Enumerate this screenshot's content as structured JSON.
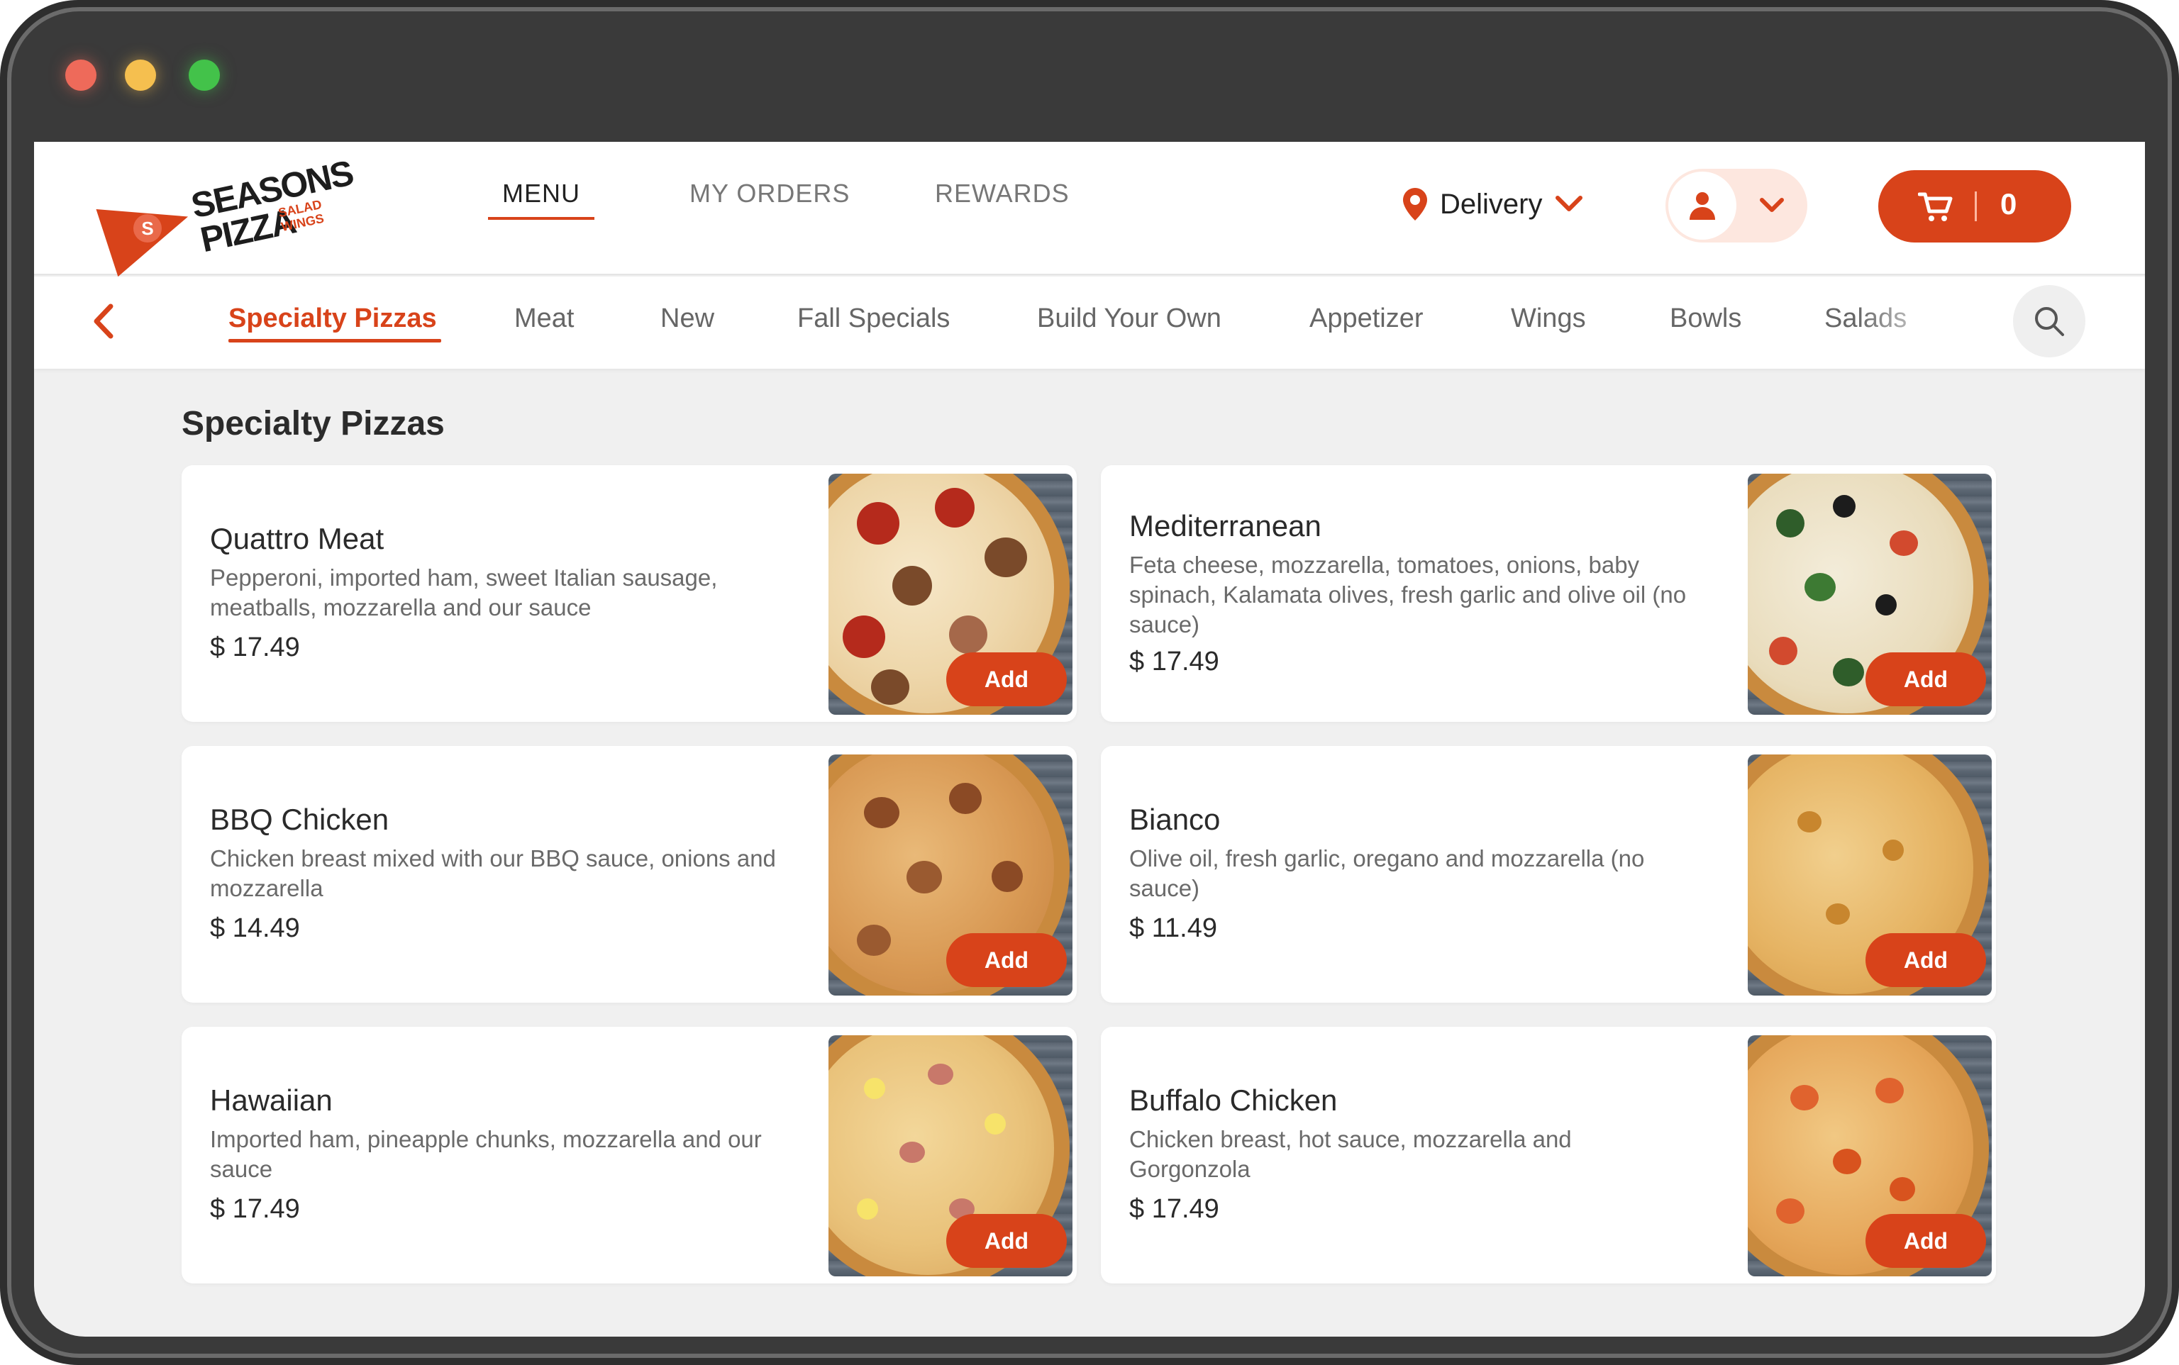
{
  "brand": {
    "line1": "SEASONS",
    "line2": "PIZZA",
    "side1": "SALAD",
    "side2": "WINGS",
    "mark": "S"
  },
  "nav": {
    "menu": "MENU",
    "orders": "MY ORDERS",
    "rewards": "REWARDS"
  },
  "delivery": {
    "label": "Delivery"
  },
  "cart": {
    "count": "0"
  },
  "categories": [
    "Specialty Pizzas",
    "Meat",
    "New",
    "Fall Specials",
    "Build Your Own",
    "Appetizer",
    "Wings",
    "Bowls",
    "Salads"
  ],
  "section_title": "Specialty Pizzas",
  "items": [
    {
      "name": "Quattro Meat",
      "description": "Pepperoni, imported ham, sweet Italian sausage, meatballs, mozzarella and our sauce",
      "price": "$ 17.49",
      "add_label": "Add"
    },
    {
      "name": "Mediterranean",
      "description": "Feta cheese, mozzarella, tomatoes, onions, baby spinach, Kalamata olives, fresh garlic and olive oil (no sauce)",
      "price": "$ 17.49",
      "add_label": "Add"
    },
    {
      "name": "BBQ Chicken",
      "description": "Chicken breast mixed with our BBQ sauce, onions and mozzarella",
      "price": "$ 14.49",
      "add_label": "Add"
    },
    {
      "name": "Bianco",
      "description": "Olive oil, fresh garlic, oregano and mozzarella (no sauce)",
      "price": "$ 11.49",
      "add_label": "Add"
    },
    {
      "name": "Hawaiian",
      "description": "Imported ham, pineapple chunks, mozzarella and our sauce",
      "price": "$ 17.49",
      "add_label": "Add"
    },
    {
      "name": "Buffalo Chicken",
      "description": "Chicken breast, hot sauce, mozzarella and Gorgonzola",
      "price": "$ 17.49",
      "add_label": "Add"
    }
  ],
  "icons": {
    "location": "location-pin-icon",
    "chevron": "chevron-down-icon",
    "user": "user-icon",
    "cart": "cart-icon",
    "back": "chevron-left-icon",
    "search": "search-icon"
  },
  "colors": {
    "accent": "#d8431a",
    "accent_light": "#fde7df",
    "background": "#f0f0f0"
  }
}
